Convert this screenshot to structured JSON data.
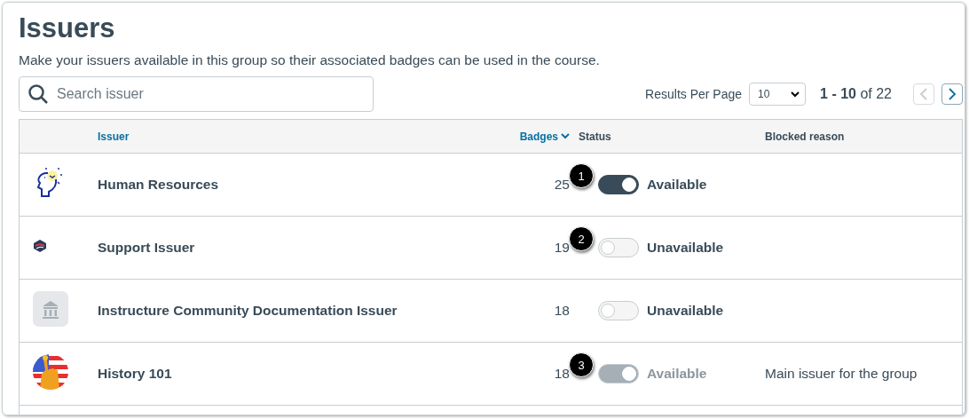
{
  "title": "Issuers",
  "description": "Make your issuers available in this group so their associated badges can be used in the course.",
  "search": {
    "placeholder": "Search issuer"
  },
  "pagination": {
    "results_label": "Results Per Page",
    "per_page": "10",
    "range": "**1 - 10** of 22",
    "prev_disabled": true,
    "next_disabled": false
  },
  "table": {
    "columns": [
      {
        "label": "Issuer",
        "sortable": true,
        "sorted": false
      },
      {
        "label": "Badges",
        "sortable": true,
        "sorted": true
      },
      {
        "label": "Status",
        "sortable": false,
        "sorted": false
      },
      {
        "label": "Blocked reason",
        "sortable": false,
        "sorted": false
      }
    ],
    "rows": [
      {
        "kind": "head",
        "name": "Human Resources",
        "badges": "25",
        "on": true,
        "disabled": false,
        "status": "Available",
        "callout": "1"
      },
      {
        "kind": "shield",
        "name": "Support Issuer",
        "badges": "19",
        "on": false,
        "disabled": false,
        "status": "Unavailable",
        "callout": "2"
      },
      {
        "kind": "building",
        "name": "Instructure Community Documentation Issuer",
        "badges": "18",
        "on": false,
        "disabled": false,
        "status": "Unavailable"
      },
      {
        "kind": "flag",
        "name": "History 101",
        "badges": "18",
        "on": true,
        "disabled": true,
        "status": "Available",
        "blocked_reason": "Main issuer for the group",
        "callout": "3"
      }
    ]
  }
}
